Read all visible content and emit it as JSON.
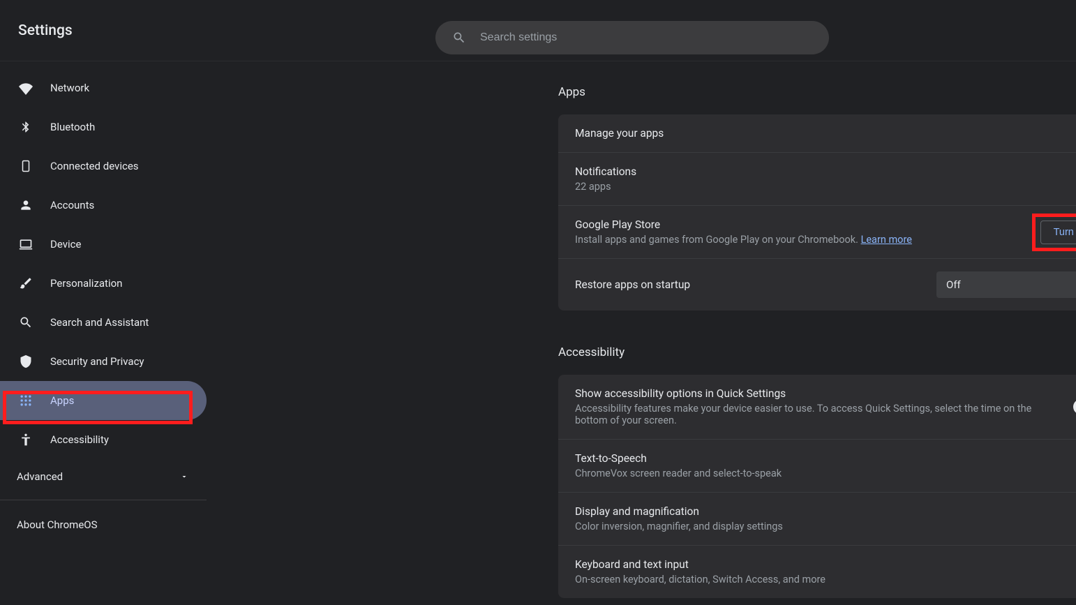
{
  "header": {
    "title": "Settings",
    "search_placeholder": "Search settings"
  },
  "sidebar": {
    "items": [
      {
        "id": "network",
        "label": "Network",
        "icon": "wifi"
      },
      {
        "id": "bluetooth",
        "label": "Bluetooth",
        "icon": "bluetooth"
      },
      {
        "id": "connected",
        "label": "Connected devices",
        "icon": "phone"
      },
      {
        "id": "accounts",
        "label": "Accounts",
        "icon": "person"
      },
      {
        "id": "device",
        "label": "Device",
        "icon": "laptop"
      },
      {
        "id": "personalization",
        "label": "Personalization",
        "icon": "brush"
      },
      {
        "id": "search",
        "label": "Search and Assistant",
        "icon": "search"
      },
      {
        "id": "security",
        "label": "Security and Privacy",
        "icon": "shield"
      },
      {
        "id": "apps",
        "label": "Apps",
        "icon": "grid",
        "active": true
      },
      {
        "id": "accessibility",
        "label": "Accessibility",
        "icon": "accessibility"
      }
    ],
    "advanced_label": "Advanced",
    "about_label": "About ChromeOS"
  },
  "sections": {
    "apps": {
      "title": "Apps",
      "rows": {
        "manage": {
          "title": "Manage your apps"
        },
        "notifications": {
          "title": "Notifications",
          "sub": "22 apps"
        },
        "play": {
          "title": "Google Play Store",
          "sub": "Install apps and games from Google Play on your Chromebook. ",
          "learn_more": "Learn more",
          "button": "Turn on"
        },
        "restore": {
          "title": "Restore apps on startup",
          "selected": "Off"
        }
      }
    },
    "accessibility": {
      "title": "Accessibility",
      "rows": {
        "quick": {
          "title": "Show accessibility options in Quick Settings",
          "sub": "Accessibility features make your device easier to use. To access Quick Settings, select the time on the bottom of your screen."
        },
        "tts": {
          "title": "Text-to-Speech",
          "sub": "ChromeVox screen reader and select-to-speak"
        },
        "display": {
          "title": "Display and magnification",
          "sub": "Color inversion, magnifier, and display settings"
        },
        "keyboard": {
          "title": "Keyboard and text input",
          "sub": "On-screen keyboard, dictation, Switch Access, and more"
        }
      }
    }
  }
}
